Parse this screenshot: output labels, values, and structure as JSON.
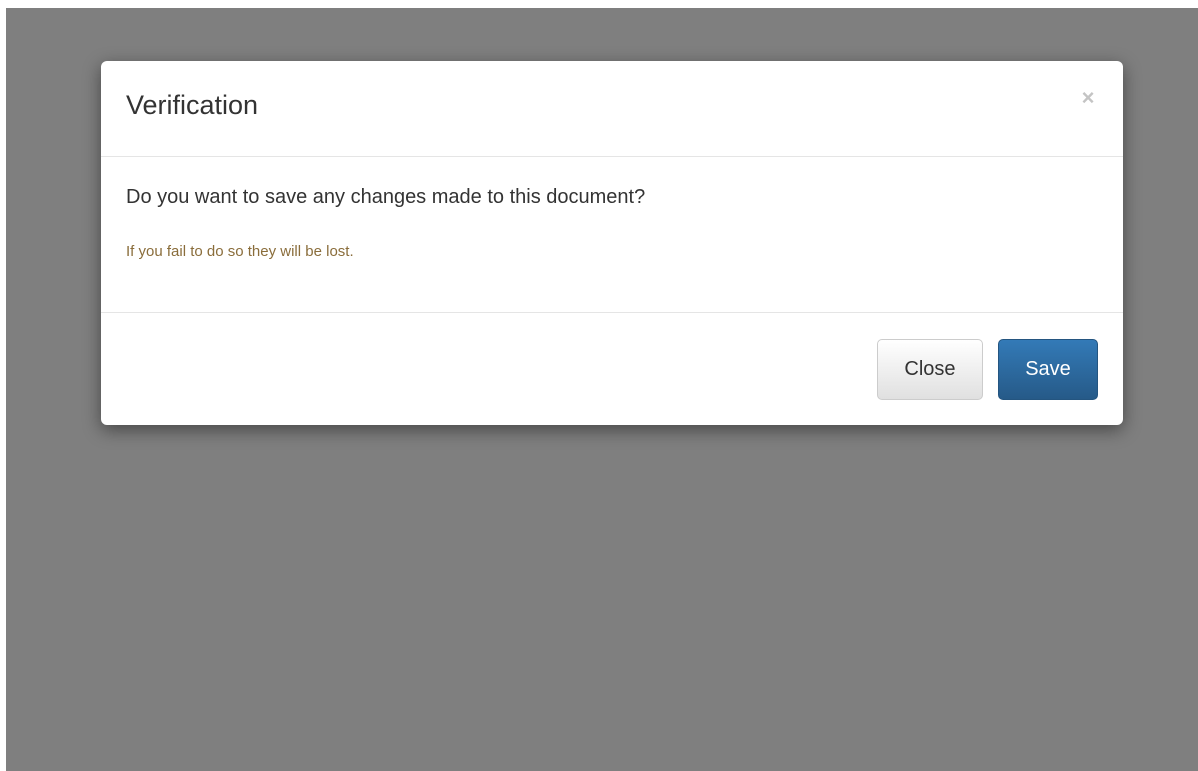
{
  "modal": {
    "title": "Verification",
    "close_icon": "close-icon",
    "close_glyph": "×",
    "question": "Do you want to save any changes made to this document?",
    "warning": "If you fail to do so they will be lost.",
    "close_label": "Close",
    "save_label": "Save"
  },
  "colors": {
    "backdrop": "#7f7f7f",
    "primary": "#337ab7",
    "warning_text": "#8a6d3b"
  }
}
